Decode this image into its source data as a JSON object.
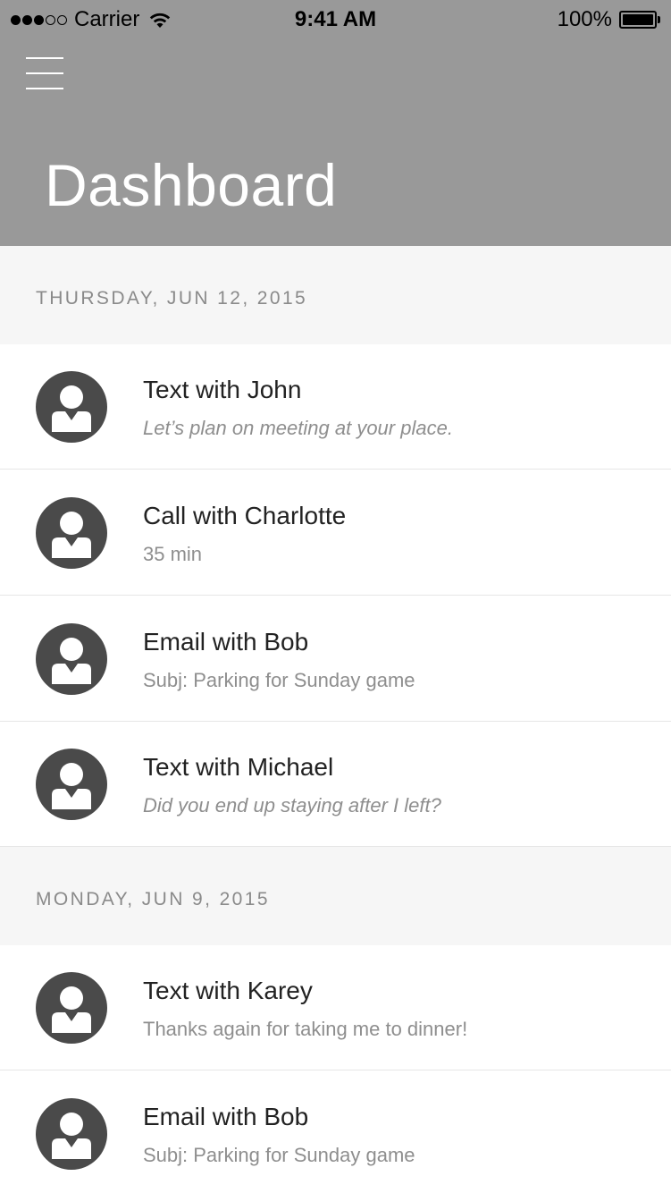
{
  "status_bar": {
    "carrier": "Carrier",
    "time": "9:41 AM",
    "battery": "100%"
  },
  "header": {
    "title": "Dashboard",
    "menu_icon": "hamburger-menu-icon",
    "background_color": "#999999"
  },
  "sections": [
    {
      "date": "THURSDAY, JUN 12, 2015",
      "items": [
        {
          "title": "Text with John",
          "subtitle": "Let’s plan on meeting at your place.",
          "italic": true
        },
        {
          "title": "Call with Charlotte",
          "subtitle": "35 min",
          "italic": false
        },
        {
          "title": "Email with Bob",
          "subtitle": "Subj: Parking for Sunday game",
          "italic": false
        },
        {
          "title": "Text with Michael",
          "subtitle": "Did you end up staying after I left?",
          "italic": true
        }
      ]
    },
    {
      "date": "MONDAY, JUN 9, 2015",
      "items": [
        {
          "title": "Text with Karey",
          "subtitle": "Thanks again for taking me to dinner!",
          "italic": false
        },
        {
          "title": "Email with Bob",
          "subtitle": "Subj: Parking for Sunday game",
          "italic": false
        }
      ]
    }
  ],
  "avatar_icon": "user-avatar-icon",
  "colors": {
    "avatar": "#4a4a4a",
    "section_bg": "#f6f6f6",
    "section_text": "#8a8a8a"
  }
}
